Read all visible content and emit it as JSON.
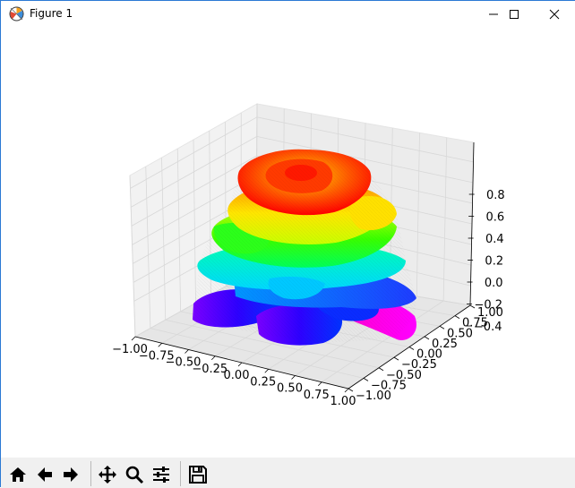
{
  "window": {
    "title": "Figure 1",
    "icon": "matplotlib-icon",
    "controls": [
      "minimize-icon",
      "maximize-icon",
      "close-icon"
    ]
  },
  "toolbar": {
    "buttons": [
      {
        "name": "home-button",
        "icon": "home-icon"
      },
      {
        "name": "back-button",
        "icon": "arrow-left-icon"
      },
      {
        "name": "forward-button",
        "icon": "arrow-right-icon"
      },
      {
        "name": "pan-button",
        "icon": "move-icon"
      },
      {
        "name": "zoom-button",
        "icon": "magnifier-icon"
      },
      {
        "name": "configure-subplots-button",
        "icon": "sliders-icon"
      },
      {
        "name": "save-button",
        "icon": "floppy-disk-icon"
      }
    ],
    "coordinates": ""
  },
  "chart_data": {
    "type": "surface3d",
    "title": "",
    "colormap": "hsv",
    "colors": [
      "#ff0000",
      "#ffff00",
      "#00ff00",
      "#00ffff",
      "#0000ff",
      "#ff00ff"
    ],
    "description_shape": "rose-like layered petals",
    "xticks": [
      "−1.00",
      "−0.75",
      "−0.50",
      "−0.25",
      "0.00",
      "0.25",
      "0.50",
      "0.75",
      "1.00"
    ],
    "yticks": [
      "−1.00",
      "−0.75",
      "−0.50",
      "−0.25",
      "0.00",
      "0.25",
      "0.50",
      "0.75",
      "1.00"
    ],
    "zticks": [
      "−0.4",
      "−0.2",
      "0.0",
      "0.2",
      "0.4",
      "0.6",
      "0.8"
    ],
    "xlim": [
      -1,
      1
    ],
    "ylim": [
      -1,
      1
    ],
    "zlim": [
      -0.45,
      0.95
    ],
    "grid": true,
    "pane_color": "#f2f2f2"
  }
}
